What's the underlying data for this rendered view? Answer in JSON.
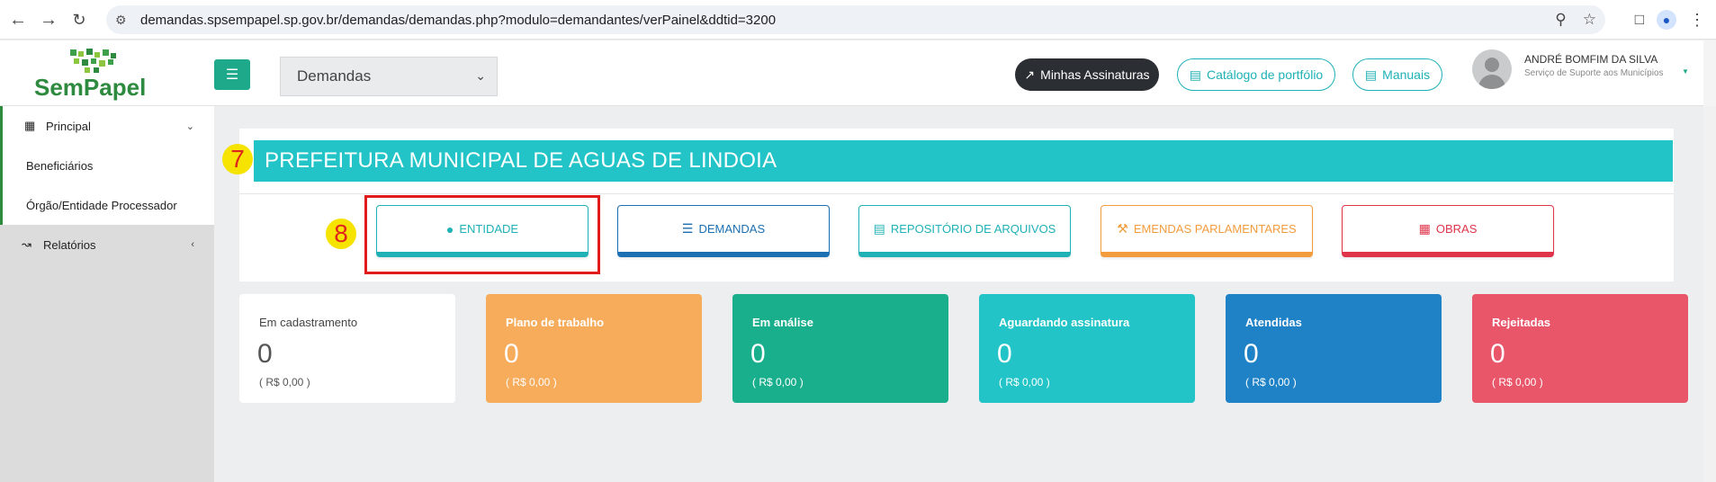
{
  "browser": {
    "url": "demandas.spsempapel.sp.gov.br/demandas/demandas.php?modulo=demandantes/verPainel&ddtid=3200"
  },
  "header": {
    "logo_text": "SemPapel",
    "module_select": "Demandas",
    "btn_signatures": "Minhas Assinaturas",
    "btn_catalog": "Catálogo de portfólio",
    "btn_manuals": "Manuais",
    "user_name": "ANDRÉ BOMFIM DA SILVA",
    "user_org": "Serviço de Suporte aos Municípios"
  },
  "sidebar": {
    "items": [
      {
        "label": "Principal"
      },
      {
        "label": "Beneficiários"
      },
      {
        "label": "Órgão/Entidade Processador"
      },
      {
        "label": "Relatórios"
      }
    ]
  },
  "main": {
    "title": "PREFEITURA MUNICIPAL DE AGUAS DE LINDOIA",
    "annotations": {
      "seven": "7",
      "eight": "8"
    },
    "nav": [
      {
        "label": "ENTIDADE"
      },
      {
        "label": "DEMANDAS"
      },
      {
        "label": "REPOSITÓRIO DE ARQUIVOS"
      },
      {
        "label": "EMENDAS PARLAMENTARES"
      },
      {
        "label": "OBRAS"
      }
    ],
    "stats": [
      {
        "label": "Em cadastramento",
        "value": "0",
        "amount": "( R$ 0,00 )"
      },
      {
        "label": "Plano de trabalho",
        "value": "0",
        "amount": "( R$ 0,00 )"
      },
      {
        "label": "Em análise",
        "value": "0",
        "amount": "( R$ 0,00 )"
      },
      {
        "label": "Aguardando assinatura",
        "value": "0",
        "amount": "( R$ 0,00 )"
      },
      {
        "label": "Atendidas",
        "value": "0",
        "amount": "( R$ 0,00 )"
      },
      {
        "label": "Rejeitadas",
        "value": "0",
        "amount": "( R$ 0,00 )"
      }
    ]
  },
  "colors": {
    "brand_green": "#2d8a3e",
    "teal": "#22c4c8",
    "blue": "#1c6fb0",
    "orange": "#f39c3d",
    "red": "#e0344a",
    "highlight_red": "#e11b1b"
  }
}
